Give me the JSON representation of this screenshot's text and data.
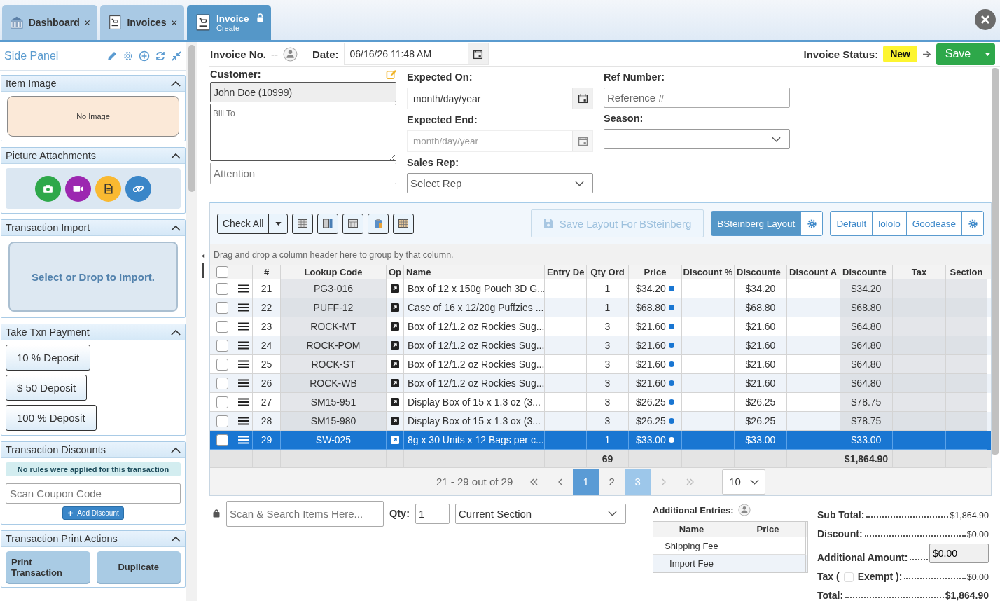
{
  "tabs": [
    {
      "label": "Dashboard",
      "kind": "closable",
      "selected": false
    },
    {
      "label": "Invoices",
      "kind": "closable",
      "selected": false
    },
    {
      "label": "Invoice",
      "sublabel": "Create",
      "kind": "locked",
      "selected": true
    }
  ],
  "side_panel": {
    "title": "Side Panel",
    "sections": [
      {
        "kind": "image",
        "title": "Item Image",
        "expanded": true,
        "text": "No Image"
      },
      {
        "kind": "attachments",
        "title": "Picture Attachments",
        "expanded": true,
        "buttons": [
          {
            "color": "#2ea84a"
          },
          {
            "color": "#9c27b0"
          },
          {
            "color": "#f9b931"
          },
          {
            "color": "#3a86c8"
          }
        ]
      },
      {
        "kind": "import",
        "title": "Transaction Import",
        "expanded": true,
        "text": "Select or Drop to Import."
      },
      {
        "kind": "payment",
        "title": "Take Txn Payment",
        "expanded": true,
        "buttons": [
          "10 % Deposit",
          "$ 50 Deposit",
          "100 % Deposit"
        ]
      },
      {
        "kind": "discounts",
        "title": "Transaction Discounts",
        "expanded": true,
        "notice": "No rules were applied for this transaction",
        "placeholder": "Scan Coupon Code",
        "button": "Add Discount"
      },
      {
        "kind": "print",
        "title": "Transaction Print Actions",
        "expanded": true,
        "buttons": [
          "Print Transaction",
          "Duplicate"
        ]
      }
    ]
  },
  "header": {
    "invoice_label": "Invoice No.",
    "invoice_value": "--",
    "date_label": "Date:",
    "date_value": "06/16/26 11:48 AM",
    "status_label": "Invoice Status:",
    "status": "New",
    "save": "Save"
  },
  "form": {
    "customer_label": "Customer:",
    "customer": "John Doe (10999)",
    "bill_to_placeholder": "Bill To",
    "attention_placeholder": "Attention",
    "expected_on_label": "Expected On:",
    "expected_on_placeholder": "month/day/year",
    "expected_end_label": "Expected End:",
    "expected_end_placeholder": "month/day/year",
    "expected_end_disabled": true,
    "sales_rep_label": "Sales Rep:",
    "sales_rep_placeholder": "Select Rep",
    "ref_label": "Ref Number:",
    "ref_placeholder": "Reference #",
    "season_label": "Season:"
  },
  "grid": {
    "check_all": "Check All",
    "save_layout": "Save Layout For BSteinberg",
    "save_layout_disabled": true,
    "user_layouts": [
      {
        "label": "BSteinberg Layout",
        "selected": true
      }
    ],
    "shared_layouts": [
      {
        "label": "Default",
        "selected": false
      },
      {
        "label": "lololo",
        "selected": false
      },
      {
        "label": "Goodease",
        "selected": false
      }
    ],
    "group_hint": "Drag and drop a column header here to group by that column.",
    "header_checked": false,
    "columns": [
      "#",
      "Lookup Code",
      "Op",
      "Name",
      "Entry De",
      "Qty Ord",
      "Price",
      "Discount %",
      "Discounte",
      "Discount A",
      "Discounte",
      "Tax",
      "Section"
    ],
    "rows": [
      {
        "number": "21",
        "lookup": "PG3-016",
        "name": "Box of 12 x 150g Pouch 3D G...",
        "qty": "1",
        "price": "$34.20",
        "discounted": "$34.20",
        "line_total": "$34.20",
        "checked": false,
        "selected": false
      },
      {
        "number": "22",
        "lookup": "PUFF-12",
        "name": "Case of 16 x 12/20g Puffzies ...",
        "qty": "1",
        "price": "$68.80",
        "discounted": "$68.80",
        "line_total": "$68.80",
        "checked": false,
        "selected": false
      },
      {
        "number": "23",
        "lookup": "ROCK-MT",
        "name": "Box of 12/1.2 oz Rockies Sug...",
        "qty": "3",
        "price": "$21.60",
        "discounted": "$21.60",
        "line_total": "$64.80",
        "checked": false,
        "selected": false
      },
      {
        "number": "24",
        "lookup": "ROCK-POM",
        "name": "Box of 12/1.2 oz Rockies Sug...",
        "qty": "3",
        "price": "$21.60",
        "discounted": "$21.60",
        "line_total": "$64.80",
        "checked": false,
        "selected": false
      },
      {
        "number": "25",
        "lookup": "ROCK-ST",
        "name": "Box of 12/1.2 oz Rockies Sug...",
        "qty": "3",
        "price": "$21.60",
        "discounted": "$21.60",
        "line_total": "$64.80",
        "checked": false,
        "selected": false
      },
      {
        "number": "26",
        "lookup": "ROCK-WB",
        "name": "Box of 12/1.2 oz Rockies Sug...",
        "qty": "3",
        "price": "$21.60",
        "discounted": "$21.60",
        "line_total": "$64.80",
        "checked": false,
        "selected": false
      },
      {
        "number": "27",
        "lookup": "SM15-951",
        "name": "Display Box of 15 x 1.3 oz (3...",
        "qty": "3",
        "price": "$26.25",
        "discounted": "$26.25",
        "line_total": "$78.75",
        "checked": false,
        "selected": false
      },
      {
        "number": "28",
        "lookup": "SM15-980",
        "name": "Display Box of 15 x 1.3 ox (3...",
        "qty": "3",
        "price": "$26.25",
        "discounted": "$26.25",
        "line_total": "$78.75",
        "checked": false,
        "selected": false
      },
      {
        "number": "29",
        "lookup": "SW-025",
        "name": "8g x 30 Units x 12 Bags per c...",
        "qty": "1",
        "price": "$33.00",
        "discounted": "$33.00",
        "line_total": "$33.00",
        "checked": false,
        "selected": true
      }
    ],
    "footer_qty": "69",
    "footer_total": "$1,864.90",
    "pager_info": "21 - 29 out of 29",
    "pages": [
      {
        "label": "1",
        "selected": false,
        "hovered": true
      },
      {
        "label": "2",
        "selected": false,
        "hovered": false
      },
      {
        "label": "3",
        "selected": true,
        "hovered": false
      }
    ],
    "page_size": "10"
  },
  "entry_bar": {
    "search_placeholder": "Scan & Search Items Here...",
    "qty_label": "Qty:",
    "qty": "1",
    "section": "Current Section"
  },
  "additional_entries": {
    "title": "Additional Entries:",
    "columns": [
      "Name",
      "Price"
    ],
    "rows": [
      "Shipping Fee",
      "Import Fee"
    ]
  },
  "totals": [
    {
      "kind": "amount",
      "label": "Sub Total:",
      "value": "$1,864.90"
    },
    {
      "kind": "amount",
      "label": "Discount:",
      "value": "$0.00"
    },
    {
      "kind": "input",
      "label": "Additional Amount:",
      "value": "$0.00"
    },
    {
      "kind": "tax",
      "label": "Tax (",
      "label_2": "Exempt ):",
      "checked": false,
      "value": "$0.00"
    },
    {
      "kind": "total",
      "label": "Total:",
      "value": "$1,864.90"
    }
  ]
}
